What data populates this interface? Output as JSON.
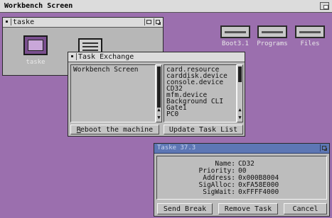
{
  "screen": {
    "title": "Workbench Screen"
  },
  "desktop_icons": [
    {
      "name": "Boot3.1"
    },
    {
      "name": "Programs"
    },
    {
      "name": "Files"
    }
  ],
  "taske_window": {
    "title": "taske",
    "icon_label": "taske"
  },
  "task_exchange": {
    "title": "Task Exchange",
    "screens": [
      "Workbench Screen"
    ],
    "tasks": [
      "card.resource",
      "carddisk.device",
      "console.device",
      "CD32",
      "mfm.device",
      "Background CLI",
      "Gate1",
      "PC0"
    ],
    "reboot_label": "Reboot the machine",
    "reboot_key": "R",
    "update_label": "Update Task List",
    "update_key": "U"
  },
  "task_info": {
    "title": "Taske 37.3",
    "lines": [
      {
        "key": "Name:",
        "value": "CD32"
      },
      {
        "key": "Priority:",
        "value": "00"
      },
      {
        "key": "Address:",
        "value": "0x000B8004"
      },
      {
        "key": "SigAlloc:",
        "value": "0xFA58E000"
      },
      {
        "key": "SigWait:",
        "value": "0xFFFF4000"
      }
    ],
    "send_break_label": "Send Break",
    "remove_task_label": "Remove Task",
    "cancel_label": "Cancel"
  }
}
